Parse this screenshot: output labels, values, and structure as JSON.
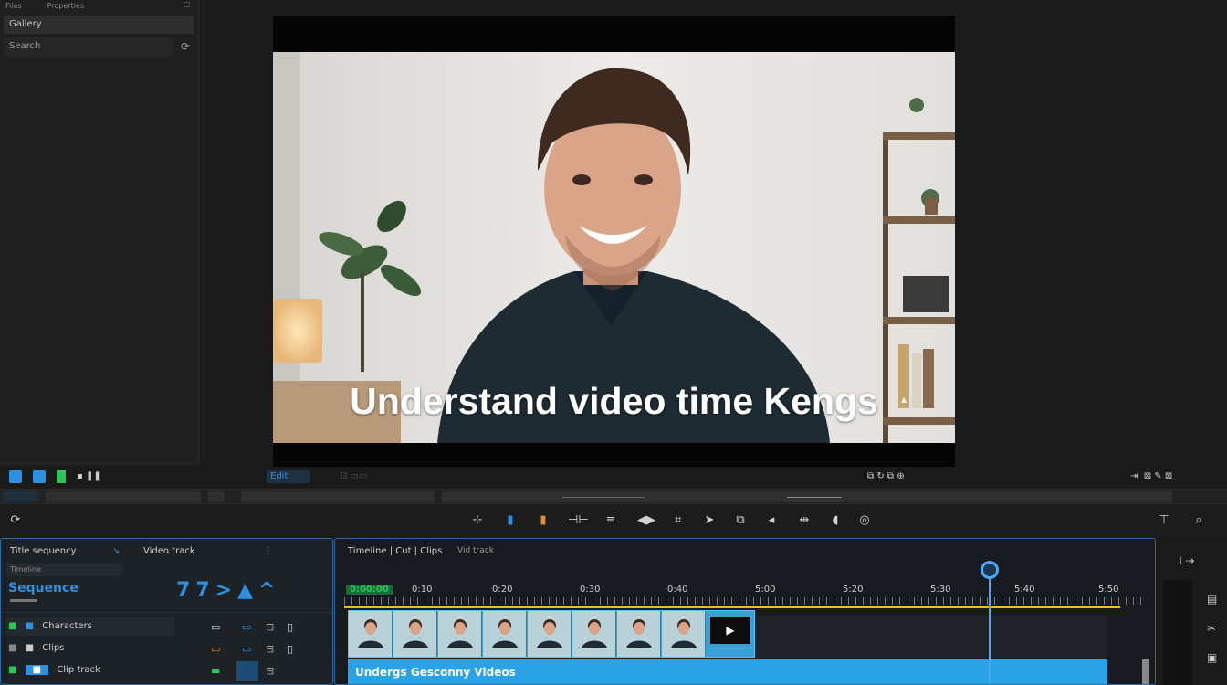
{
  "sidebar": {
    "header_labels": [
      "Files",
      "Properties"
    ],
    "item1": "Gallery",
    "item2": "Search"
  },
  "preview": {
    "caption": "Understand video time Kengs"
  },
  "transport": {
    "label": "Edit"
  },
  "left_panel": {
    "tab1": "Title sequency",
    "tab2": "Video track",
    "subtitle": "Timeline",
    "section_label": "Sequence",
    "row1": "Characters",
    "row2": "Clips",
    "row3": "Clip track",
    "nav_glyphs": [
      "7",
      "7",
      ">",
      "▲",
      "^"
    ]
  },
  "timeline": {
    "header": "Timeline | Cut | Clips",
    "header2": "Vid track",
    "start_label": "0:00:00",
    "ticks": [
      "0:10",
      "0:20",
      "0:30",
      "0:40",
      "5:00",
      "5:20",
      "5:30",
      "5:40",
      "5:50"
    ],
    "caption_clip": "Undergs Gesconny Videos",
    "clip_count": 8
  },
  "colors": {
    "accent": "#2f8fe0",
    "panel_border": "#2f6aa8",
    "caption_track": "#29a3e6",
    "playhead": "#4aa8ff",
    "ruler_line": "#e6c21a",
    "green": "#2ec65a"
  }
}
